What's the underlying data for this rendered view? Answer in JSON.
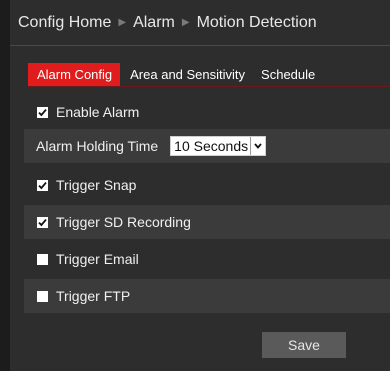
{
  "breadcrumb": [
    "Config Home",
    "Alarm",
    "Motion Detection"
  ],
  "tabs": [
    {
      "label": "Alarm Config",
      "active": true
    },
    {
      "label": "Area and Sensitivity",
      "active": false
    },
    {
      "label": "Schedule",
      "active": false
    }
  ],
  "enable_alarm": {
    "label": "Enable Alarm",
    "checked": true
  },
  "holding_time": {
    "label": "Alarm Holding Time",
    "value": "10 Seconds"
  },
  "trigger_snap": {
    "label": "Trigger Snap",
    "checked": true
  },
  "trigger_sd": {
    "label": "Trigger SD Recording",
    "checked": true
  },
  "trigger_email": {
    "label": "Trigger Email",
    "checked": false
  },
  "trigger_ftp": {
    "label": "Trigger FTP",
    "checked": false
  },
  "save_label": "Save",
  "colors": {
    "accent_tab": "#e01c1c",
    "background": "#2d2d2d",
    "row_shade": "#3b3b3b"
  }
}
